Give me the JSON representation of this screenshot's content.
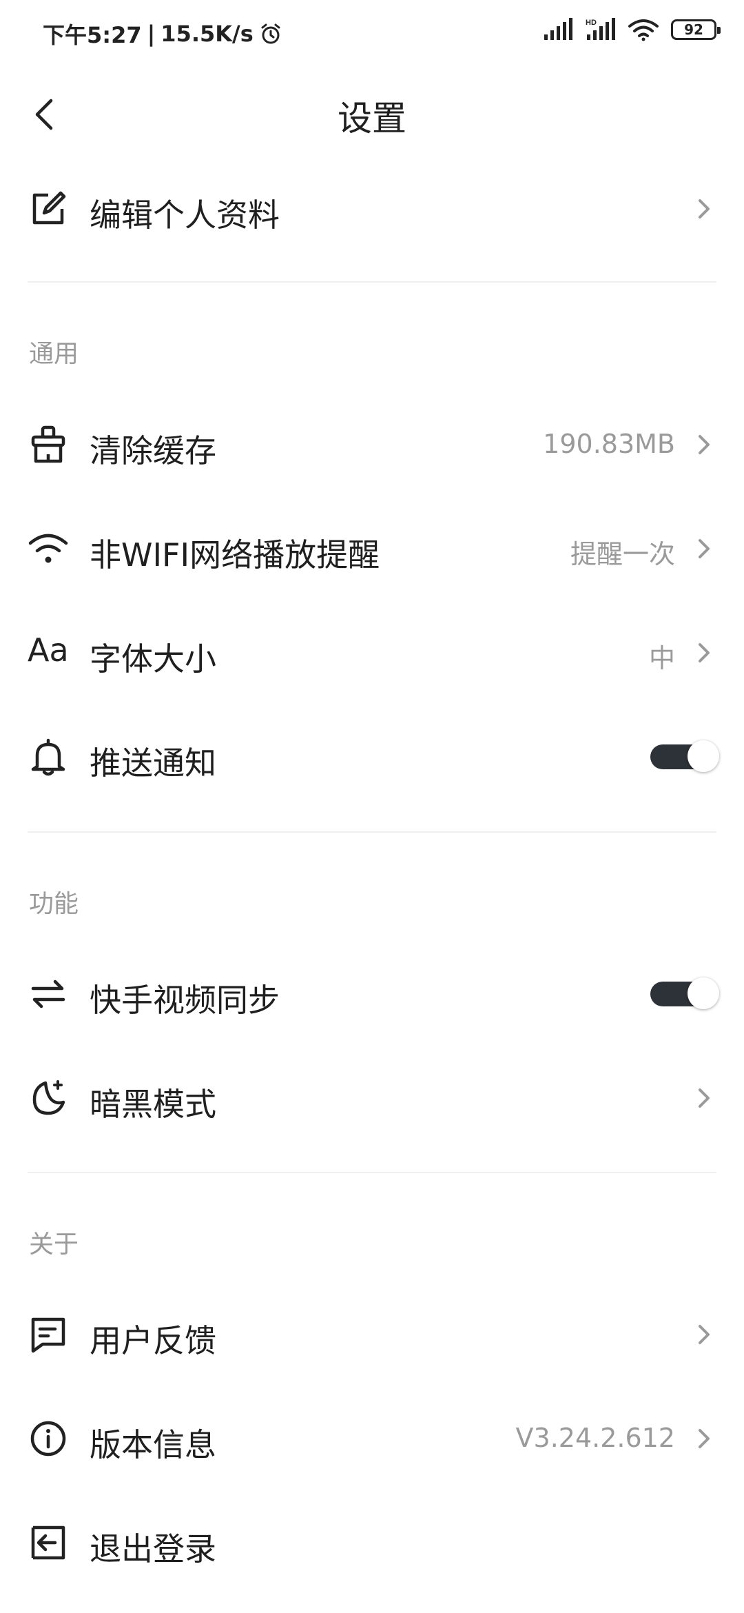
{
  "status_bar": {
    "time": "下午5:27",
    "network_speed": "15.5K/s",
    "battery": "92"
  },
  "header": {
    "title": "设置"
  },
  "profile": {
    "edit_label": "编辑个人资料"
  },
  "sections": {
    "general": "通用",
    "features": "功能",
    "about": "关于"
  },
  "general": {
    "clear_cache": {
      "label": "清除缓存",
      "value": "190.83MB"
    },
    "non_wifi": {
      "label": "非WIFI网络播放提醒",
      "value": "提醒一次"
    },
    "font_size": {
      "label": "字体大小",
      "value": "中",
      "icon_text": "Aa"
    },
    "push": {
      "label": "推送通知",
      "enabled": true
    }
  },
  "features": {
    "kuaishou_sync": {
      "label": "快手视频同步",
      "enabled": true
    },
    "dark_mode": {
      "label": "暗黑模式"
    }
  },
  "about": {
    "feedback": {
      "label": "用户反馈"
    },
    "version": {
      "label": "版本信息",
      "value": "V3.24.2.612"
    },
    "logout": {
      "label": "退出登录"
    }
  }
}
